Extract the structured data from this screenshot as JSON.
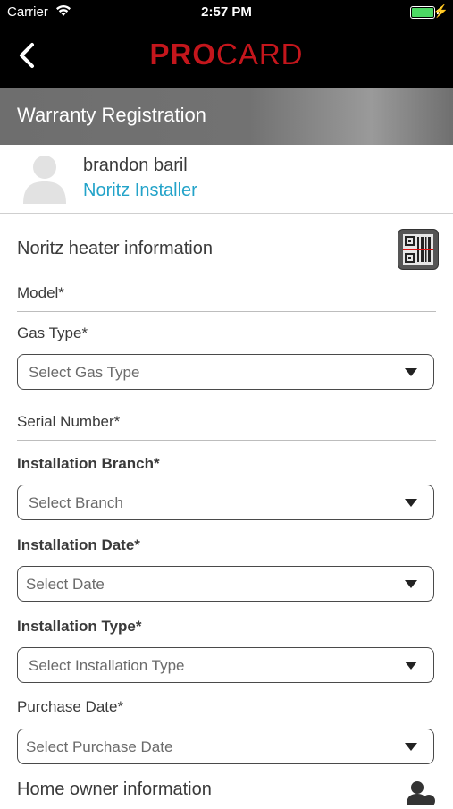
{
  "status_bar": {
    "carrier": "Carrier",
    "time": "2:57 PM"
  },
  "nav": {
    "logo_pro": "PRO",
    "logo_card": "CARD",
    "brand_color": "#c4161c"
  },
  "header": {
    "title": "Warranty Registration"
  },
  "user": {
    "name": "brandon baril",
    "role": "Noritz Installer",
    "role_color": "#23a3c9"
  },
  "heater": {
    "section_title": "Noritz heater information",
    "qr_icon": "qr-scan-icon",
    "model_label": "Model*",
    "gas_type_label": "Gas Type*",
    "gas_type_placeholder": "Select Gas Type",
    "serial_label": "Serial Number*",
    "branch_label": "Installation Branch*",
    "branch_placeholder": "Select Branch",
    "date_label": "Installation Date*",
    "date_placeholder": "Select Date",
    "type_label": "Installation Type*",
    "type_placeholder": "Select Installation Type",
    "purchase_label": "Purchase Date*",
    "purchase_placeholder": "Select Purchase Date"
  },
  "owner": {
    "section_title": "Home owner information",
    "icon": "add-user-icon"
  }
}
